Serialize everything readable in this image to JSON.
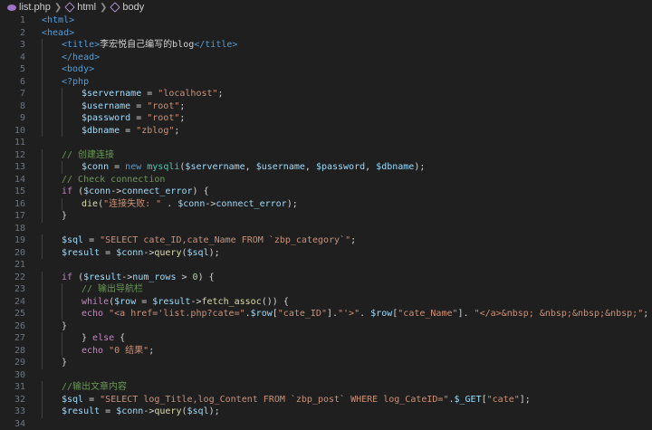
{
  "breadcrumb": {
    "file": "list.php",
    "items": [
      "html",
      "body"
    ],
    "icons": [
      "php-file-icon",
      "symbol-icon",
      "symbol-icon"
    ]
  },
  "colors": {
    "background": "#1f1f1f",
    "line_number": "#6e7681",
    "tag": "#569cd6",
    "variable": "#9cdcfe",
    "string": "#ce9178",
    "comment": "#6a9955",
    "keyword": "#c586c0",
    "function": "#dcdcaa",
    "class": "#4ec9b0",
    "number": "#b5cea8"
  },
  "lines": [
    {
      "n": "1",
      "indent": 0,
      "t": [
        [
          "tag",
          "<html>"
        ]
      ]
    },
    {
      "n": "2",
      "indent": 0,
      "t": [
        [
          "tag",
          "<head>"
        ]
      ]
    },
    {
      "n": "3",
      "indent": 1,
      "t": [
        [
          "tag",
          "<title>"
        ],
        [
          "txt",
          "李宏悦自己编写的blog"
        ],
        [
          "tag",
          "</title>"
        ]
      ]
    },
    {
      "n": "4",
      "indent": 1,
      "t": [
        [
          "tag",
          "</head>"
        ]
      ]
    },
    {
      "n": "5",
      "indent": 1,
      "t": [
        [
          "tag",
          "<body>"
        ]
      ]
    },
    {
      "n": "6",
      "indent": 1,
      "t": [
        [
          "tag",
          "<?php"
        ]
      ]
    },
    {
      "n": "7",
      "indent": 2,
      "t": [
        [
          "var",
          "$servername"
        ],
        [
          "op",
          " = "
        ],
        [
          "str",
          "\"localhost\""
        ],
        [
          "op",
          ";"
        ]
      ]
    },
    {
      "n": "8",
      "indent": 2,
      "t": [
        [
          "var",
          "$username"
        ],
        [
          "op",
          " = "
        ],
        [
          "str",
          "\"root\""
        ],
        [
          "op",
          ";"
        ]
      ]
    },
    {
      "n": "9",
      "indent": 2,
      "t": [
        [
          "var",
          "$password"
        ],
        [
          "op",
          " = "
        ],
        [
          "str",
          "\"root\""
        ],
        [
          "op",
          ";"
        ]
      ]
    },
    {
      "n": "10",
      "indent": 2,
      "t": [
        [
          "var",
          "$dbname"
        ],
        [
          "op",
          " = "
        ],
        [
          "str",
          "\"zblog\""
        ],
        [
          "op",
          ";"
        ]
      ]
    },
    {
      "n": "11",
      "indent": 0,
      "t": []
    },
    {
      "n": "12",
      "indent": 1,
      "t": [
        [
          "cmt",
          "// 创建连接"
        ]
      ]
    },
    {
      "n": "13",
      "indent": 2,
      "t": [
        [
          "var",
          "$conn"
        ],
        [
          "op",
          " = "
        ],
        [
          "tag",
          "new "
        ],
        [
          "cls",
          "mysqli"
        ],
        [
          "op",
          "("
        ],
        [
          "var",
          "$servername"
        ],
        [
          "op",
          ", "
        ],
        [
          "var",
          "$username"
        ],
        [
          "op",
          ", "
        ],
        [
          "var",
          "$password"
        ],
        [
          "op",
          ", "
        ],
        [
          "var",
          "$dbname"
        ],
        [
          "op",
          ");"
        ]
      ]
    },
    {
      "n": "14",
      "indent": 1,
      "t": [
        [
          "cmt",
          "// Check connection"
        ]
      ]
    },
    {
      "n": "15",
      "indent": 1,
      "t": [
        [
          "kw",
          "if "
        ],
        [
          "op",
          "("
        ],
        [
          "var",
          "$conn"
        ],
        [
          "op",
          "->"
        ],
        [
          "var",
          "connect_error"
        ],
        [
          "op",
          ") {"
        ]
      ]
    },
    {
      "n": "16",
      "indent": 2,
      "t": [
        [
          "fn",
          "die"
        ],
        [
          "op",
          "("
        ],
        [
          "str",
          "\"连接失败: \""
        ],
        [
          "op",
          " . "
        ],
        [
          "var",
          "$conn"
        ],
        [
          "op",
          "->"
        ],
        [
          "var",
          "connect_error"
        ],
        [
          "op",
          ");"
        ]
      ]
    },
    {
      "n": "17",
      "indent": 1,
      "t": [
        [
          "op",
          "}"
        ]
      ]
    },
    {
      "n": "18",
      "indent": 0,
      "t": []
    },
    {
      "n": "19",
      "indent": 1,
      "t": [
        [
          "var",
          "$sql"
        ],
        [
          "op",
          " = "
        ],
        [
          "str",
          "\"SELECT cate_ID,cate_Name FROM `zbp_category`\""
        ],
        [
          "op",
          ";"
        ]
      ]
    },
    {
      "n": "20",
      "indent": 1,
      "t": [
        [
          "var",
          "$result"
        ],
        [
          "op",
          " = "
        ],
        [
          "var",
          "$conn"
        ],
        [
          "op",
          "->"
        ],
        [
          "fn",
          "query"
        ],
        [
          "op",
          "("
        ],
        [
          "var",
          "$sql"
        ],
        [
          "op",
          ");"
        ]
      ]
    },
    {
      "n": "21",
      "indent": 0,
      "t": []
    },
    {
      "n": "22",
      "indent": 1,
      "t": [
        [
          "kw",
          "if "
        ],
        [
          "op",
          "("
        ],
        [
          "var",
          "$result"
        ],
        [
          "op",
          "->"
        ],
        [
          "var",
          "num_rows"
        ],
        [
          "op",
          " > "
        ],
        [
          "num",
          "0"
        ],
        [
          "op",
          ") {"
        ]
      ]
    },
    {
      "n": "23",
      "indent": 2,
      "t": [
        [
          "cmt",
          "// 输出导航栏"
        ]
      ]
    },
    {
      "n": "24",
      "indent": 2,
      "t": [
        [
          "kw",
          "while"
        ],
        [
          "op",
          "("
        ],
        [
          "var",
          "$row"
        ],
        [
          "op",
          " = "
        ],
        [
          "var",
          "$result"
        ],
        [
          "op",
          "->"
        ],
        [
          "fn",
          "fetch_assoc"
        ],
        [
          "op",
          "()) {"
        ]
      ]
    },
    {
      "n": "25",
      "indent": 2,
      "t": [
        [
          "kw",
          "echo "
        ],
        [
          "str",
          "\"<a href='list.php?cate=\""
        ],
        [
          "op",
          "."
        ],
        [
          "var",
          "$row"
        ],
        [
          "op",
          "["
        ],
        [
          "str",
          "\"cate_ID\""
        ],
        [
          "op",
          "]."
        ],
        [
          "str",
          "\"'>\""
        ],
        [
          "op",
          ". "
        ],
        [
          "var",
          "$row"
        ],
        [
          "op",
          "["
        ],
        [
          "str",
          "\"cate_Name\""
        ],
        [
          "op",
          "]. "
        ],
        [
          "str",
          "\"</a>&nbsp; &nbsp;&nbsp;&nbsp;\""
        ],
        [
          "op",
          ";"
        ]
      ]
    },
    {
      "n": "26",
      "indent": 1,
      "t": [
        [
          "op",
          "}"
        ]
      ]
    },
    {
      "n": "27",
      "indent": 2,
      "t": [
        [
          "op",
          "} "
        ],
        [
          "kw",
          "else"
        ],
        [
          "op",
          " {"
        ]
      ]
    },
    {
      "n": "28",
      "indent": 2,
      "t": [
        [
          "kw",
          "echo "
        ],
        [
          "str",
          "\"0 结果\""
        ],
        [
          "op",
          ";"
        ]
      ]
    },
    {
      "n": "29",
      "indent": 1,
      "t": [
        [
          "op",
          "}"
        ]
      ]
    },
    {
      "n": "30",
      "indent": 0,
      "t": []
    },
    {
      "n": "31",
      "indent": 1,
      "t": [
        [
          "cmt",
          "//输出文章内容"
        ]
      ]
    },
    {
      "n": "32",
      "indent": 1,
      "t": [
        [
          "var",
          "$sql"
        ],
        [
          "op",
          " = "
        ],
        [
          "str",
          "\"SELECT log_Title,log_Content FROM `zbp_post` WHERE log_CateID=\""
        ],
        [
          "op",
          "."
        ],
        [
          "var",
          "$_GET"
        ],
        [
          "op",
          "["
        ],
        [
          "str",
          "\"cate\""
        ],
        [
          "op",
          "];"
        ]
      ]
    },
    {
      "n": "33",
      "indent": 1,
      "t": [
        [
          "var",
          "$result"
        ],
        [
          "op",
          " = "
        ],
        [
          "var",
          "$conn"
        ],
        [
          "op",
          "->"
        ],
        [
          "fn",
          "query"
        ],
        [
          "op",
          "("
        ],
        [
          "var",
          "$sql"
        ],
        [
          "op",
          ");"
        ]
      ]
    },
    {
      "n": "34",
      "indent": 0,
      "t": []
    }
  ]
}
